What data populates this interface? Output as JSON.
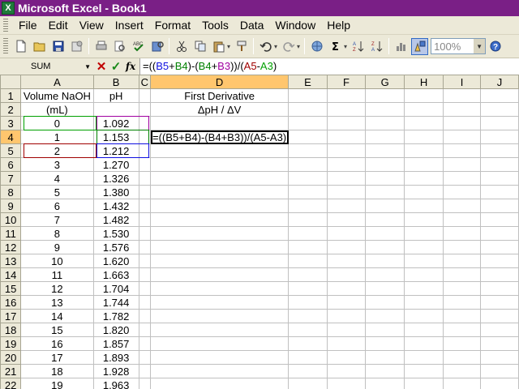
{
  "window": {
    "title": "Microsoft Excel - Book1",
    "app_icon_letter": "X"
  },
  "menu": [
    "File",
    "Edit",
    "View",
    "Insert",
    "Format",
    "Tools",
    "Data",
    "Window",
    "Help"
  ],
  "toolbar": {
    "zoom_value": "100%"
  },
  "formula_bar": {
    "name_box": "SUM",
    "cancel_symbol": "✕",
    "enter_symbol": "✓",
    "fx_label": "fx",
    "formula_parts": [
      {
        "text": "=((",
        "ref": ""
      },
      {
        "text": "B5",
        "ref": "b5"
      },
      {
        "text": "+",
        "ref": ""
      },
      {
        "text": "B4",
        "ref": "b4"
      },
      {
        "text": ")-(",
        "ref": ""
      },
      {
        "text": "B4",
        "ref": "b4"
      },
      {
        "text": "+",
        "ref": ""
      },
      {
        "text": "B3",
        "ref": "b3"
      },
      {
        "text": "))/(",
        "ref": ""
      },
      {
        "text": "A5",
        "ref": "a5"
      },
      {
        "text": "-",
        "ref": ""
      },
      {
        "text": "A3",
        "ref": "a3"
      },
      {
        "text": ")",
        "ref": ""
      }
    ]
  },
  "columns": [
    "A",
    "B",
    "C",
    "D",
    "E",
    "F",
    "G",
    "H",
    "I",
    "J"
  ],
  "active_cell": {
    "column": "D",
    "row": 4,
    "text": "=((B5+B4)-(B4+B3))/(A5-A3)"
  },
  "rows": [
    {
      "n": "1",
      "a": "Volume NaOH",
      "b": "pH",
      "d": "First Derivative"
    },
    {
      "n": "2",
      "a": "(mL)",
      "b": "",
      "d": "ΔpH / ΔV"
    },
    {
      "n": "3",
      "a": "0",
      "b": "1.092",
      "d": ""
    },
    {
      "n": "4",
      "a": "1",
      "b": "1.153",
      "d": "=((B5+B4)-(B4+B3))/(A5-A3)"
    },
    {
      "n": "5",
      "a": "2",
      "b": "1.212",
      "d": ""
    },
    {
      "n": "6",
      "a": "3",
      "b": "1.270",
      "d": ""
    },
    {
      "n": "7",
      "a": "4",
      "b": "1.326",
      "d": ""
    },
    {
      "n": "8",
      "a": "5",
      "b": "1.380",
      "d": ""
    },
    {
      "n": "9",
      "a": "6",
      "b": "1.432",
      "d": ""
    },
    {
      "n": "10",
      "a": "7",
      "b": "1.482",
      "d": ""
    },
    {
      "n": "11",
      "a": "8",
      "b": "1.530",
      "d": ""
    },
    {
      "n": "12",
      "a": "9",
      "b": "1.576",
      "d": ""
    },
    {
      "n": "13",
      "a": "10",
      "b": "1.620",
      "d": ""
    },
    {
      "n": "14",
      "a": "11",
      "b": "1.663",
      "d": ""
    },
    {
      "n": "15",
      "a": "12",
      "b": "1.704",
      "d": ""
    },
    {
      "n": "16",
      "a": "13",
      "b": "1.744",
      "d": ""
    },
    {
      "n": "17",
      "a": "14",
      "b": "1.782",
      "d": ""
    },
    {
      "n": "18",
      "a": "15",
      "b": "1.820",
      "d": ""
    },
    {
      "n": "19",
      "a": "16",
      "b": "1.857",
      "d": ""
    },
    {
      "n": "20",
      "a": "17",
      "b": "1.893",
      "d": ""
    },
    {
      "n": "21",
      "a": "18",
      "b": "1.928",
      "d": ""
    },
    {
      "n": "22",
      "a": "19",
      "b": "1.963",
      "d": ""
    }
  ],
  "reference_colors": {
    "b5": "#1010e0",
    "b4": "#008000",
    "b3": "#a000a0",
    "a5": "#a00000",
    "a3": "#00a000"
  }
}
